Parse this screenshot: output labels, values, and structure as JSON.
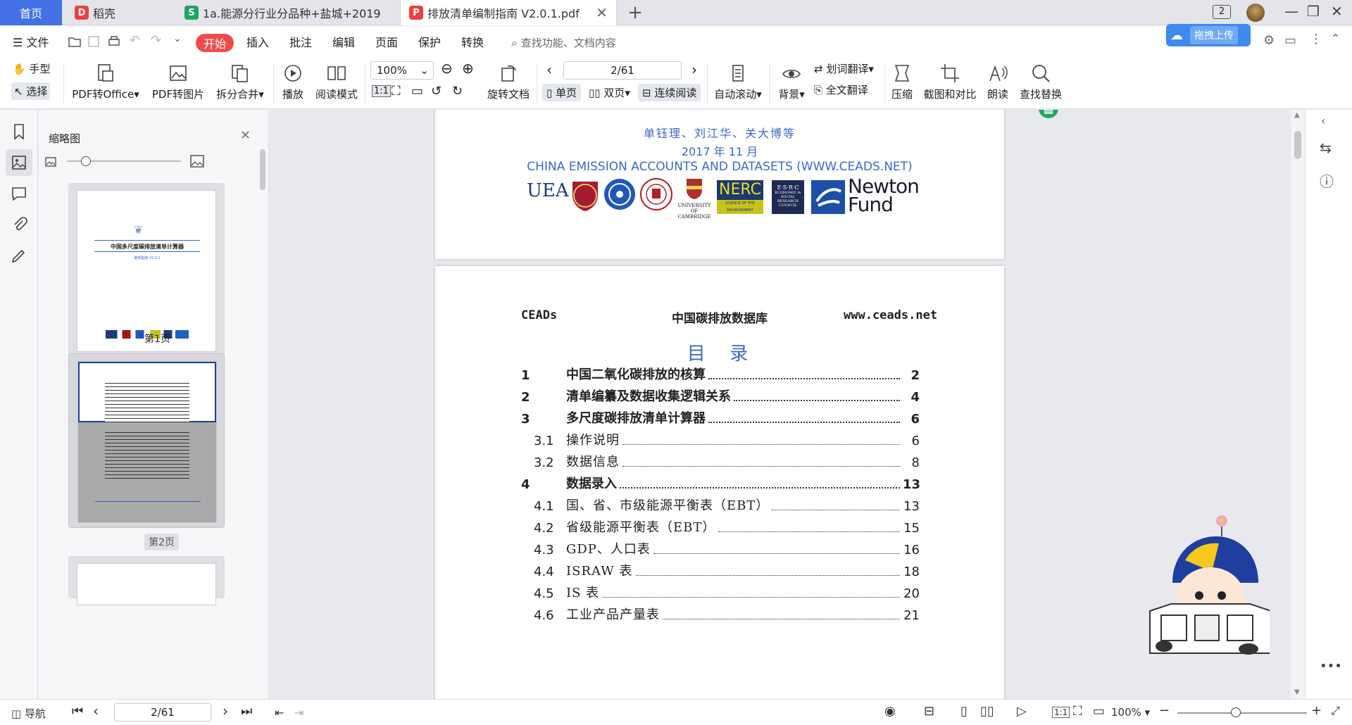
{
  "tabs": {
    "home": "首页",
    "daoke": "稻壳",
    "sheet": "1a.能源分行业分品种+盐城+2019",
    "pdf": "排放清单编制指南 V2.0.1.pdf",
    "daoke_icon": "D",
    "sheet_icon": "S",
    "pdf_icon": "P",
    "badge": "2"
  },
  "menu": {
    "file": "文件",
    "start": "开始",
    "insert": "插入",
    "annotate": "批注",
    "edit": "编辑",
    "page": "页面",
    "protect": "保护",
    "convert": "转换",
    "search_placeholder": "查找功能、文档内容",
    "upload": "拖拽上传"
  },
  "ribbon": {
    "hand": "手型",
    "select": "选择",
    "pdf_to_office": "PDF转Office",
    "pdf_to_image": "PDF转图片",
    "split_merge": "拆分合并",
    "play": "播放",
    "read_mode": "阅读模式",
    "zoom": "100%",
    "rotate": "旋转文档",
    "page_input": "2/61",
    "single": "单页",
    "double": "双页",
    "continuous": "连续阅读",
    "auto_scroll": "自动滚动",
    "background": "背景",
    "word_translate": "划词翻译",
    "full_translate": "全文翻译",
    "compress": "压缩",
    "screenshot": "截图和对比",
    "read_aloud": "朗读",
    "find_replace": "查找替换"
  },
  "thumbs": {
    "title": "缩略图",
    "page1_label": "第1页",
    "page2_label": "第2页"
  },
  "page1": {
    "authors": "单钰理、刘江华、关大博等",
    "date": "2017 年 11 月",
    "org": "CHINA EMISSION ACCOUNTS AND DATASETS (WWW.CEADS.NET)",
    "logos": {
      "uea": "UEA",
      "nerc": "NERC",
      "nerc_sub": "SCIENCE OF THE ENVIRONMENT",
      "esrc": "E·S·R·C",
      "esrc_sub": "ECONOMIC & SOCIAL RESEARCH COUNCIL",
      "cambridge": "UNIVERSITY OF CAMBRIDGE",
      "newton1": "Newton",
      "newton2": "Fund"
    }
  },
  "thumb_page1": {
    "title": "中国多尺度碳排放清单计算器",
    "version": "使用指南 V2.0.1"
  },
  "page2": {
    "header_left": "CEADs",
    "header_center": "中国碳排放数据库",
    "header_right": "www.ceads.net",
    "toc_title": "目  录",
    "toc": [
      {
        "num": "1",
        "title": "中国二氧化碳排放的核算",
        "page": "2",
        "level": "main"
      },
      {
        "num": "2",
        "title": "清单编纂及数据收集逻辑关系",
        "page": "4",
        "level": "main"
      },
      {
        "num": "3",
        "title": "多尺度碳排放清单计算器",
        "page": "6",
        "level": "main"
      },
      {
        "num": "3.1",
        "title": "操作说明",
        "page": "6",
        "level": "sub"
      },
      {
        "num": "3.2",
        "title": "数据信息",
        "page": "8",
        "level": "sub"
      },
      {
        "num": "4",
        "title": "数据录入",
        "page": "13",
        "level": "main"
      },
      {
        "num": "4.1",
        "title": "国、省、市级能源平衡表（EBT）",
        "page": "13",
        "level": "sub"
      },
      {
        "num": "4.2",
        "title": "省级能源平衡表（EBT）",
        "page": "15",
        "level": "sub"
      },
      {
        "num": "4.3",
        "title": "GDP、人口表",
        "page": "16",
        "level": "sub"
      },
      {
        "num": "4.4",
        "title": "ISRAW 表",
        "page": "18",
        "level": "sub"
      },
      {
        "num": "4.5",
        "title": "IS 表",
        "page": "20",
        "level": "sub"
      },
      {
        "num": "4.6",
        "title": "工业产品产量表",
        "page": "21",
        "level": "sub"
      }
    ]
  },
  "status": {
    "nav": "导航",
    "page_input": "2/61",
    "zoom": "100%"
  },
  "colors": {
    "accent": "#4472e6",
    "start_button": "#f24b4b",
    "pdf_blue": "#3b68c8",
    "green": "#1fa463"
  }
}
